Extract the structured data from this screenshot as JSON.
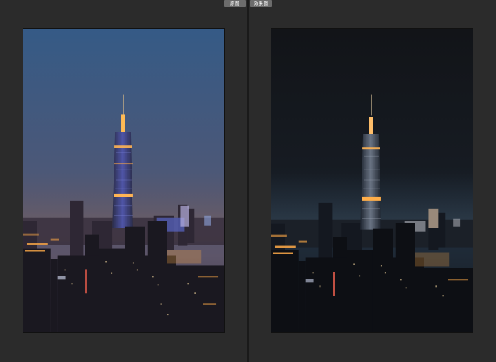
{
  "header": {
    "before_label": "原图",
    "after_label": "效果图"
  },
  "colors": {
    "background": "#2b2b2b",
    "divider": "#1a1a1a",
    "label_bg": "#6c6c6c",
    "label_text": "#f2f2f2",
    "sky_before_top": "#3d5f86",
    "sky_before_bottom": "#5a5268",
    "sky_after_top": "#13161b",
    "sky_after_bottom": "#1f2c3b",
    "city_lights": "#f3a346"
  },
  "images": {
    "before": {
      "name": "original-photo"
    },
    "after": {
      "name": "edited-photo"
    }
  }
}
